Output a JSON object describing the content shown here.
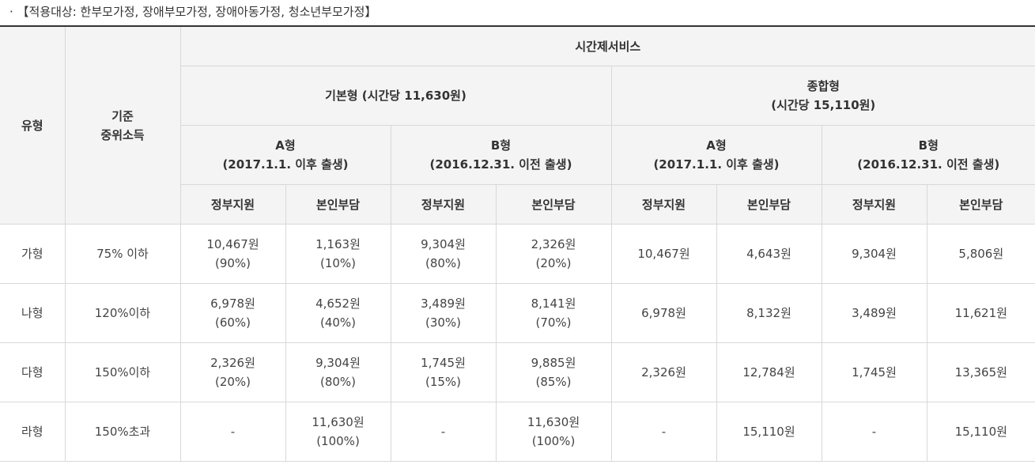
{
  "note": "· 【적용대상: 한부모가정, 장애부모가정, 장애아동가정, 청소년부모가정】",
  "header": {
    "type": "유형",
    "income_line1": "기준",
    "income_line2": "중위소득",
    "service": "시간제서비스",
    "basic": "기본형 (시간당 11,630원)",
    "comp_line1": "종합형",
    "comp_line2": "(시간당 15,110원)",
    "basic_a_line1": "A형",
    "basic_a_line2": "(2017.1.1. 이후 출생)",
    "basic_b_line1": "B형",
    "basic_b_line2": "(2016.12.31. 이전 출생)",
    "comp_a_line1": "A형",
    "comp_a_line2": "(2017.1.1. 이후 출생)",
    "comp_b_line1": "B형",
    "comp_b_line2": "(2016.12.31. 이전 출생)",
    "gov": "정부지원",
    "self": "본인부담"
  },
  "rows": [
    {
      "type": "가형",
      "income": "75% 이하",
      "ba_gov": "10,467원",
      "ba_gov_pct": "(90%)",
      "ba_self": "1,163원",
      "ba_self_pct": "(10%)",
      "bb_gov": "9,304원",
      "bb_gov_pct": "(80%)",
      "bb_self": "2,326원",
      "bb_self_pct": "(20%)",
      "ca_gov": "10,467원",
      "ca_self": "4,643원",
      "cb_gov": "9,304원",
      "cb_self": "5,806원"
    },
    {
      "type": "나형",
      "income": "120%이하",
      "ba_gov": "6,978원",
      "ba_gov_pct": "(60%)",
      "ba_self": "4,652원",
      "ba_self_pct": "(40%)",
      "bb_gov": "3,489원",
      "bb_gov_pct": "(30%)",
      "bb_self": "8,141원",
      "bb_self_pct": "(70%)",
      "ca_gov": "6,978원",
      "ca_self": "8,132원",
      "cb_gov": "3,489원",
      "cb_self": "11,621원"
    },
    {
      "type": "다형",
      "income": "150%이하",
      "ba_gov": "2,326원",
      "ba_gov_pct": "(20%)",
      "ba_self": "9,304원",
      "ba_self_pct": "(80%)",
      "bb_gov": "1,745원",
      "bb_gov_pct": "(15%)",
      "bb_self": "9,885원",
      "bb_self_pct": "(85%)",
      "ca_gov": "2,326원",
      "ca_self": "12,784원",
      "cb_gov": "1,745원",
      "cb_self": "13,365원"
    },
    {
      "type": "라형",
      "income": "150%초과",
      "ba_gov": "-",
      "ba_gov_pct": "",
      "ba_self": "11,630원",
      "ba_self_pct": "(100%)",
      "bb_gov": "-",
      "bb_gov_pct": "",
      "bb_self": "11,630원",
      "bb_self_pct": "(100%)",
      "ca_gov": "-",
      "ca_self": "15,110원",
      "cb_gov": "-",
      "cb_self": "15,110원"
    }
  ]
}
